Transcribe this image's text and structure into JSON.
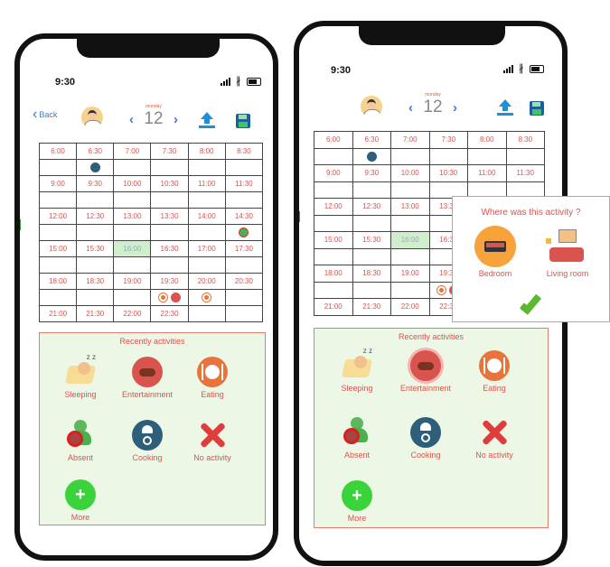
{
  "status": {
    "time": "9:30"
  },
  "header": {
    "back_label": "Back",
    "day": "monday",
    "date": "12"
  },
  "schedule": [
    [
      "6:00",
      "6:30",
      "7:00",
      "7:30",
      "8:00",
      "8:30"
    ],
    [
      "",
      "cook",
      "",
      "",
      "",
      ""
    ],
    [
      "9:00",
      "9:30",
      "10:00",
      "10:30",
      "11:00",
      "11:30"
    ],
    [
      "",
      "",
      "",
      "",
      "",
      ""
    ],
    [
      "12:00",
      "12:30",
      "13:00",
      "13:30",
      "14:00",
      "14:30"
    ],
    [
      "",
      "",
      "",
      "",
      "",
      "absent"
    ],
    [
      "15:00",
      "15:30",
      "16:00",
      "16:30",
      "17:00",
      "17:30"
    ],
    [
      "",
      "",
      "",
      "",
      "",
      ""
    ],
    [
      "18:00",
      "18:30",
      "19:00",
      "19:30",
      "20:00",
      "20:30"
    ],
    [
      "",
      "",
      "",
      "eat,ent",
      "eat",
      ""
    ],
    [
      "21:00",
      "21:30",
      "22:00",
      "22:30",
      "",
      ""
    ]
  ],
  "highlight_cell": "16:00",
  "recent": {
    "title": "Recently activities",
    "items": [
      {
        "label": "Sleeping",
        "icon": "sleeping-icon"
      },
      {
        "label": "Entertainment",
        "icon": "entertainment-icon"
      },
      {
        "label": "Eating",
        "icon": "eating-icon"
      },
      {
        "label": "Absent",
        "icon": "absent-icon"
      },
      {
        "label": "Cooking",
        "icon": "cooking-icon"
      },
      {
        "label": "No activity",
        "icon": "no-activity-icon"
      },
      {
        "label": "More",
        "icon": "plus-icon"
      }
    ]
  },
  "popup": {
    "question": "Where was this activity ?",
    "options": [
      {
        "label": "Bedroom",
        "icon": "bedroom-icon"
      },
      {
        "label": "Living room",
        "icon": "living-room-icon"
      }
    ],
    "confirm_icon": "checkmark-icon"
  },
  "colors": {
    "accent": "#d9534f",
    "link": "#3a7bd5",
    "panel": "#edf7e6",
    "highlight": "#cfeecc"
  }
}
